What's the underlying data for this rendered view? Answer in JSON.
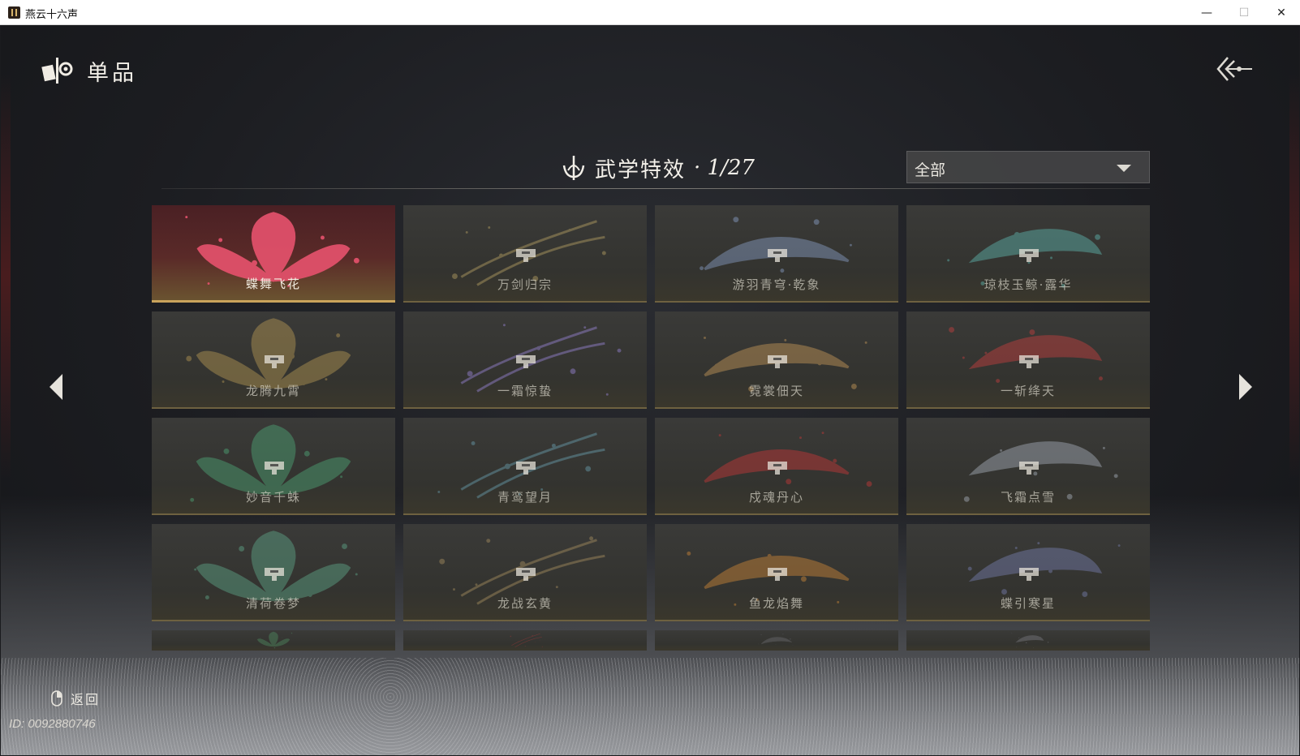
{
  "window": {
    "title": "燕云十六声",
    "controls": {
      "minimize": "—",
      "maximize": "☐",
      "close": "✕"
    }
  },
  "header": {
    "icon": "collection-emblem-icon",
    "title": "单品",
    "back_icon": "back-arrow-icon"
  },
  "section": {
    "icon": "martial-emblem-icon",
    "label": "武学特效",
    "count": "· 1/27"
  },
  "filter": {
    "selected": "全部",
    "icon": "dropdown-caret-icon"
  },
  "effects": [
    {
      "name": "蝶舞飞花",
      "selected": true,
      "locked": false,
      "accent": "#e0506a"
    },
    {
      "name": "万剑归宗",
      "selected": false,
      "locked": true,
      "accent": "#b8a264"
    },
    {
      "name": "游羽青穹·乾象",
      "selected": false,
      "locked": true,
      "accent": "#8aa0c8"
    },
    {
      "name": "琼枝玉鲸·露华",
      "selected": false,
      "locked": true,
      "accent": "#5fb8b0"
    },
    {
      "name": "龙腾九霄",
      "selected": false,
      "locked": true,
      "accent": "#b89a55"
    },
    {
      "name": "一霜惊蛰",
      "selected": false,
      "locked": true,
      "accent": "#9a86d8"
    },
    {
      "name": "霓裳佃天",
      "selected": false,
      "locked": true,
      "accent": "#c89a5a"
    },
    {
      "name": "一斩绛天",
      "selected": false,
      "locked": true,
      "accent": "#c84040"
    },
    {
      "name": "妙音千蛛",
      "selected": false,
      "locked": true,
      "accent": "#4fa878"
    },
    {
      "name": "青鸾望月",
      "selected": false,
      "locked": true,
      "accent": "#6aa0b0"
    },
    {
      "name": "戍魂丹心",
      "selected": false,
      "locked": true,
      "accent": "#c83838"
    },
    {
      "name": "飞霜点雪",
      "selected": false,
      "locked": true,
      "accent": "#a8b0bc"
    },
    {
      "name": "清荷卷梦",
      "selected": false,
      "locked": true,
      "accent": "#5fa88a"
    },
    {
      "name": "龙战玄黄",
      "selected": false,
      "locked": true,
      "accent": "#a89060"
    },
    {
      "name": "鱼龙焰舞",
      "selected": false,
      "locked": true,
      "accent": "#d08838"
    },
    {
      "name": "蝶引寒星",
      "selected": false,
      "locked": true,
      "accent": "#7880b0"
    }
  ],
  "partial_row_accents": [
    "#4f8a60",
    "#a83838",
    "#6a6a6e",
    "#7a7a80"
  ],
  "nav": {
    "prev_icon": "page-left-icon",
    "next_icon": "page-right-icon"
  },
  "footer": {
    "return_label": "返回",
    "return_icon": "mouse-icon",
    "player_id": "ID: 0092880746"
  }
}
